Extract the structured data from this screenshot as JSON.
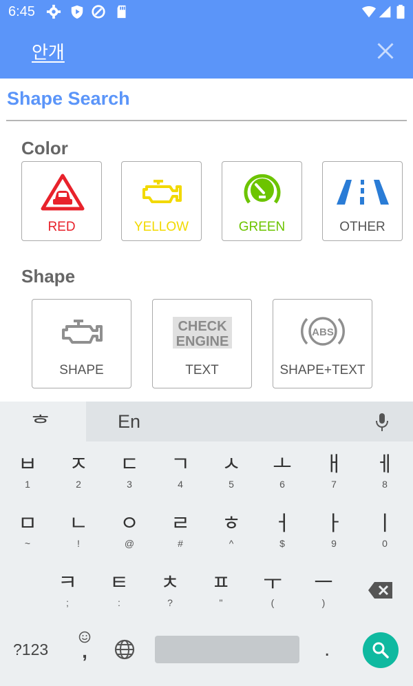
{
  "status_bar": {
    "time": "6:45"
  },
  "app_bar": {
    "title": "안개"
  },
  "main": {
    "title": "Shape Search",
    "color_group": {
      "label": "Color",
      "items": [
        {
          "label": "RED",
          "color": "#e8222b",
          "icon": "hazard-car-icon"
        },
        {
          "label": "YELLOW",
          "color": "#f2d900",
          "icon": "check-engine-icon"
        },
        {
          "label": "GREEN",
          "color": "#6cc400",
          "icon": "cruise-control-icon"
        },
        {
          "label": "OTHER",
          "color": "#555555",
          "icon": "lane-departure-icon"
        }
      ]
    },
    "shape_group": {
      "label": "Shape",
      "items": [
        {
          "label": "SHAPE",
          "icon": "engine-shape-icon"
        },
        {
          "label": "TEXT",
          "icon": "check-engine-text-icon",
          "icon_text_line1": "CHECK",
          "icon_text_line2": "ENGINE"
        },
        {
          "label": "SHAPE+TEXT",
          "icon": "abs-icon",
          "icon_text": "ABS"
        }
      ]
    }
  },
  "keyboard": {
    "mode_key": "ᄒ",
    "suggestion": "En",
    "row1": [
      {
        "main": "ㅂ",
        "sub": "1"
      },
      {
        "main": "ㅈ",
        "sub": "2"
      },
      {
        "main": "ㄷ",
        "sub": "3"
      },
      {
        "main": "ㄱ",
        "sub": "4"
      },
      {
        "main": "ㅅ",
        "sub": "5"
      },
      {
        "main": "ㅗ",
        "sub": "6"
      },
      {
        "main": "ㅐ",
        "sub": "7"
      },
      {
        "main": "ㅔ",
        "sub": "8"
      }
    ],
    "row2": [
      {
        "main": "ㅁ",
        "sub": "~"
      },
      {
        "main": "ㄴ",
        "sub": "!"
      },
      {
        "main": "ㅇ",
        "sub": "@"
      },
      {
        "main": "ㄹ",
        "sub": "#"
      },
      {
        "main": "ㅎ",
        "sub": "^"
      },
      {
        "main": "ㅓ",
        "sub": "$"
      },
      {
        "main": "ㅏ",
        "sub": "9"
      },
      {
        "main": "ㅣ",
        "sub": "0"
      }
    ],
    "row3": [
      {
        "main": "ㅋ",
        "sub": ";"
      },
      {
        "main": "ㅌ",
        "sub": ":"
      },
      {
        "main": "ㅊ",
        "sub": "?"
      },
      {
        "main": "ㅍ",
        "sub": "\""
      },
      {
        "main": "ㅜ",
        "sub": "("
      },
      {
        "main": "ㅡ",
        "sub": ")"
      }
    ],
    "symbols_key": "?123",
    "comma_key": ",",
    "period_key": ".",
    "accent_color": "#0fb9a0"
  }
}
